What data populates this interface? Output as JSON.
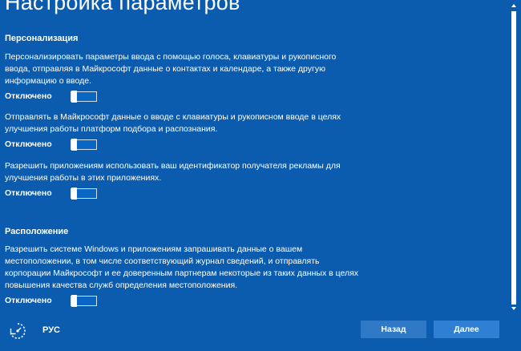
{
  "page": {
    "title": "Настройка параметров"
  },
  "sections": [
    {
      "heading": "Персонализация",
      "settings": [
        {
          "description": "Персонализировать параметры ввода с помощью голоса, клавиатуры и рукописного ввода, отправляя в Майкрософт данные о контактах и календаре, а также другую информацию о вводе.",
          "toggle_label": "Отключено",
          "state": "off"
        },
        {
          "description": "Отправлять в Майкрософт данные о вводе с клавиатуры и рукописном вводе в целях улучшения работы платформ подбора и распознания.",
          "toggle_label": "Отключено",
          "state": "off"
        },
        {
          "description": "Разрешить приложениям использовать ваш идентификатор получателя рекламы для улучшения работы в этих приложениях.",
          "toggle_label": "Отключено",
          "state": "off"
        }
      ]
    },
    {
      "heading": "Расположение",
      "settings": [
        {
          "description": "Разрешить системе Windows и приложениям запрашивать данные о вашем местоположении, в том числе соответствующий журнал сведений, и отправлять корпорации Майкрософт и ее доверенным партнерам некоторые из таких данных в целях повышения качества служб определения местоположения.",
          "toggle_label": "Отключено",
          "state": "off"
        }
      ]
    }
  ],
  "footer": {
    "language": "РУС",
    "back_label": "Назад",
    "next_label": "Далее",
    "accessibility_icon": "ease-of-access-icon"
  },
  "scrollbar": {
    "up_icon": "chevron-up-icon",
    "down_icon": "chevron-down-icon"
  },
  "colors": {
    "background": "#0b5cae",
    "button": "#2f79c6",
    "text": "#ffffff"
  }
}
